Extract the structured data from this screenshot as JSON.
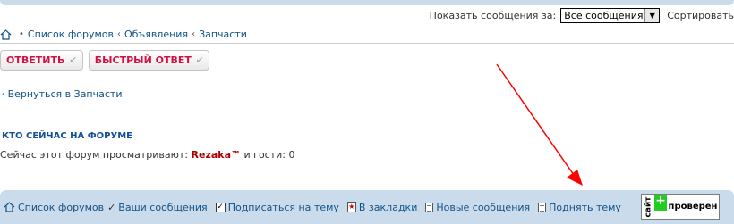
{
  "sort_bar": {
    "show_label": "Показать сообщения за:",
    "select_value": "Все сообщения",
    "sort_label": "Сортировать"
  },
  "breadcrumbs": {
    "items": [
      "Список форумов",
      "Объявления",
      "Запчасти"
    ],
    "separator": "‹"
  },
  "actions": {
    "reply_label": "ОТВЕТИТЬ",
    "quick_reply_label": "БЫСТРЫЙ ОТВЕТ"
  },
  "back_link": {
    "label": "Вернуться в Запчасти"
  },
  "who_online": {
    "heading": "КТО СЕЙЧАС НА ФОРУМЕ",
    "prefix": "Сейчас этот форум просматривают:",
    "user": "Rezaka™",
    "suffix": "и гости: 0"
  },
  "footer": {
    "forum_list": "Список форумов",
    "your_posts": "Ваши сообщения",
    "subscribe": "Подписаться на тему",
    "bookmarks": "В закладки",
    "new_posts": "Новые сообщения",
    "bump": "Поднять тему"
  },
  "badge": {
    "side_text": "сайт",
    "plus": "+",
    "text": "проверен"
  },
  "colors": {
    "accent_link": "#105289",
    "button_text": "#d31141",
    "username": "#aa0000",
    "bar_background": "#cadceb",
    "annotation_arrow": "#ff0000"
  }
}
